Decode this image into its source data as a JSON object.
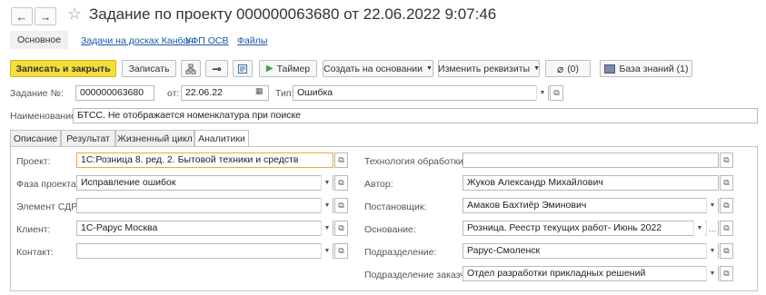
{
  "window": {
    "title": "Задание по проекту 000000063680 от 22.06.2022 9:07:46",
    "back_icon": "←",
    "forward_icon": "→",
    "star_icon": "☆"
  },
  "nav": {
    "active": "Основное",
    "links": [
      "Задачи на досках Канбан",
      "УФП ОСВ",
      "Файлы"
    ]
  },
  "toolbar": {
    "save_close": "Записать и закрыть",
    "save": "Записать",
    "timer": "Таймер",
    "create_based": "Создать на основании",
    "change_props": "Изменить реквизиты",
    "attachments_count": "(0)",
    "knowledge_base": "База знаний (1)"
  },
  "header": {
    "task_no_label": "Задание №:",
    "task_no": "000000063680",
    "date_label": "от:",
    "date": "22.06.22",
    "type_label": "Тип:",
    "type": "Ошибка",
    "name_label": "Наименование:",
    "name": "БТСС. Не отображается номенклатура при поиске"
  },
  "tabs": [
    "Описание",
    "Результат",
    "Жизненный цикл",
    "Аналитики"
  ],
  "active_tab": "Аналитики",
  "left_fields": {
    "project_label": "Проект:",
    "project": "1С:Розница 8. ред. 2. Бытовой техники и средств",
    "phase_label": "Фаза проекта:",
    "phase": "Исправление ошибок",
    "sdr_label": "Элемент СДР:",
    "sdr": "",
    "client_label": "Клиент:",
    "client": "1С-Рарус Москва",
    "contact_label": "Контакт:",
    "contact": ""
  },
  "right_fields": {
    "tech_label": "Технология обработки:",
    "tech": "",
    "author_label": "Автор:",
    "author": "Жуков Александр Михайлович",
    "setter_label": "Постановщик:",
    "setter": "Амаков Бахтиёр Эминович",
    "basis_label": "Основание:",
    "basis": "Розница. Реестр текущих работ- Июнь 2022",
    "dept_label": "Подразделение:",
    "dept": "Рарус-Смоленск",
    "client_dept_label": "Подразделение заказчика:",
    "client_dept": "Отдел разработки прикладных решений"
  }
}
